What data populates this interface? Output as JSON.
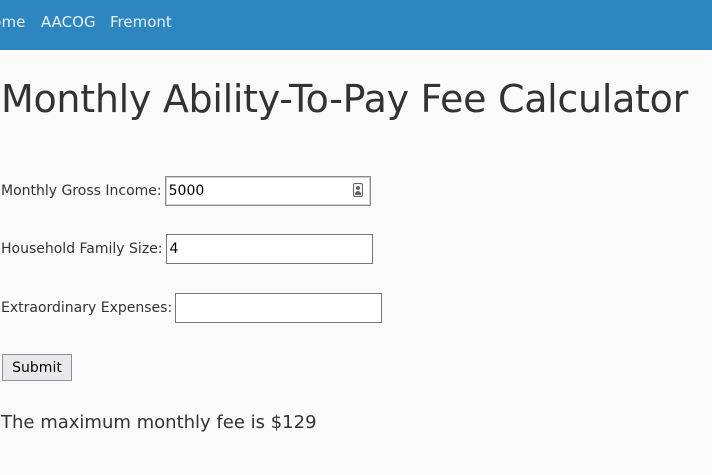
{
  "nav": {
    "items": [
      {
        "label": "Home"
      },
      {
        "label": "AACOG"
      },
      {
        "label": "Fremont"
      }
    ]
  },
  "page": {
    "title": "Monthly Ability-To-Pay Fee Calculator"
  },
  "form": {
    "income": {
      "label": "Monthly Gross Income:",
      "value": "5000"
    },
    "family_size": {
      "label": "Household Family Size:",
      "value": "4"
    },
    "expenses": {
      "label": "Extraordinary Expenses:",
      "value": ""
    },
    "submit_label": "Submit"
  },
  "result": {
    "text": "The maximum monthly fee is $129"
  },
  "colors": {
    "navbar": "#2e86c1",
    "background": "#fafafa"
  }
}
